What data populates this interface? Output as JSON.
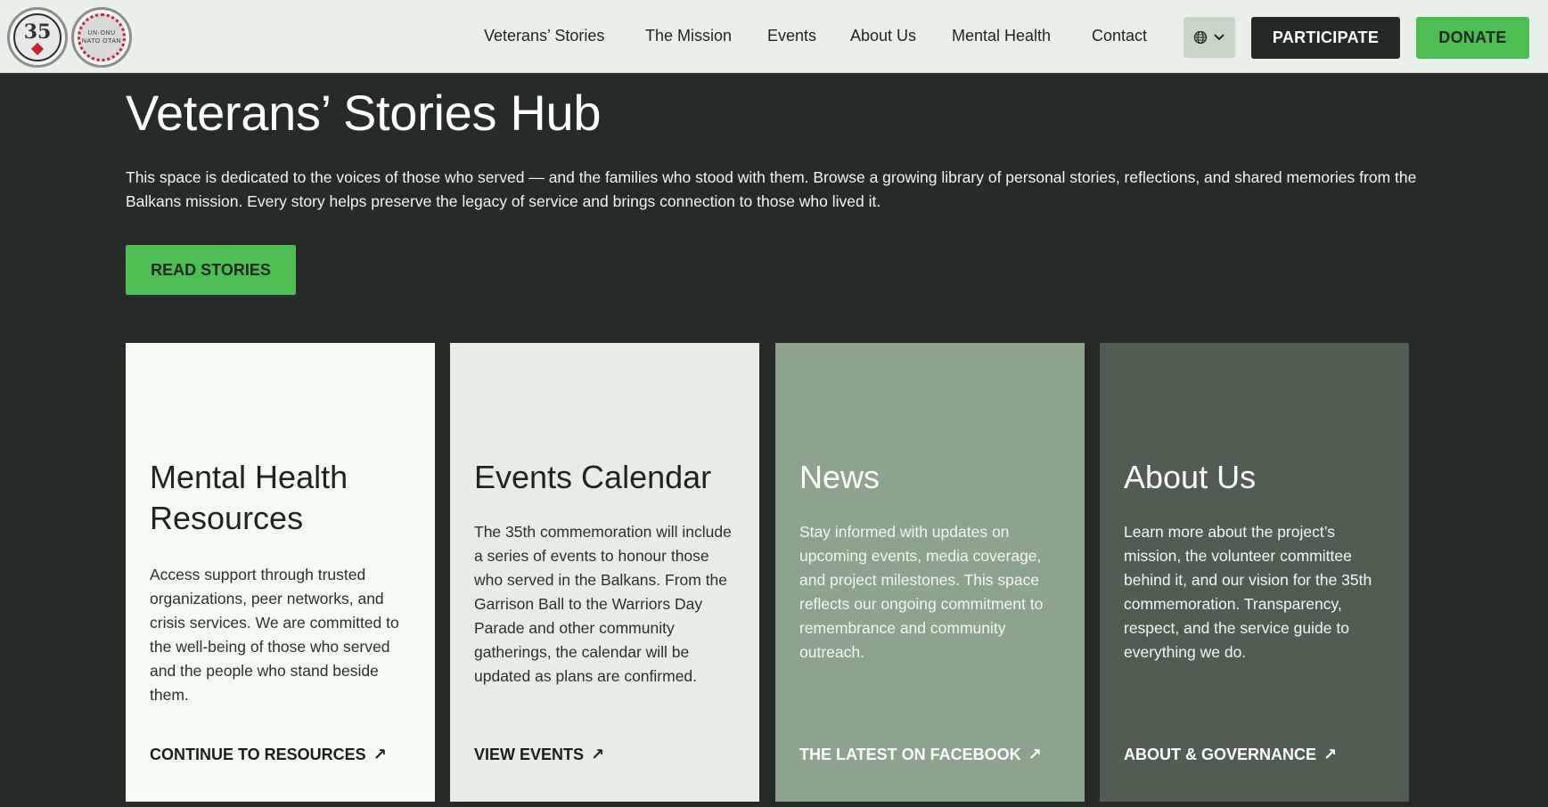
{
  "header": {
    "logo1_text": "35",
    "logo2_text": "UN·ONU NATO OTAN",
    "nav": [
      "Veterans’ Stories",
      "The Mission",
      "Events",
      "About Us",
      "Mental Health",
      "Contact"
    ],
    "participate": "PARTICIPATE",
    "donate": "DONATE"
  },
  "hero": {
    "title": "Veterans’ Stories Hub",
    "description": "This space is dedicated to the voices of those who served — and the families who stood with them. Browse a growing library of personal stories, reflections, and shared memories from the Balkans mission. Every story helps preserve the legacy of service and brings connection to those who lived it.",
    "button": "READ STORIES"
  },
  "cards": [
    {
      "title": "Mental Health Resources",
      "body": "Access support through trusted organizations, peer networks, and crisis services. We are committed to the well-being of those who served and the people who stand beside them.",
      "link": "CONTINUE TO RESOURCES"
    },
    {
      "title": "Events Calendar",
      "body": "The 35th commemoration will include a series of events to honour those who served in the Balkans. From the Garrison Ball to the Warriors Day Parade and other community gatherings, the calendar will be updated as plans are confirmed.",
      "link": "VIEW EVENTS"
    },
    {
      "title": "News",
      "body": "Stay informed with updates on upcoming events, media coverage, and project milestones. This space reflects our ongoing commitment to remembrance and community outreach.",
      "link": "THE LATEST ON FACEBOOK"
    },
    {
      "title": "About Us",
      "body": "Learn more about the project’s mission, the volunteer committee behind it, and our vision for the 35th commemoration. Transparency, respect, and the service guide to everything we do.",
      "link": "ABOUT & GOVERNANCE"
    }
  ],
  "icons": {
    "language": "globe-icon",
    "dropdown": "chevron-down-icon",
    "link_arrow": "arrow-up-right-icon",
    "arrow_glyph": "↗"
  },
  "colors": {
    "header_bg": "#e9efe9",
    "page_bg": "#262b28",
    "accent_green": "#4ebd54",
    "dark_button": "#232826"
  }
}
